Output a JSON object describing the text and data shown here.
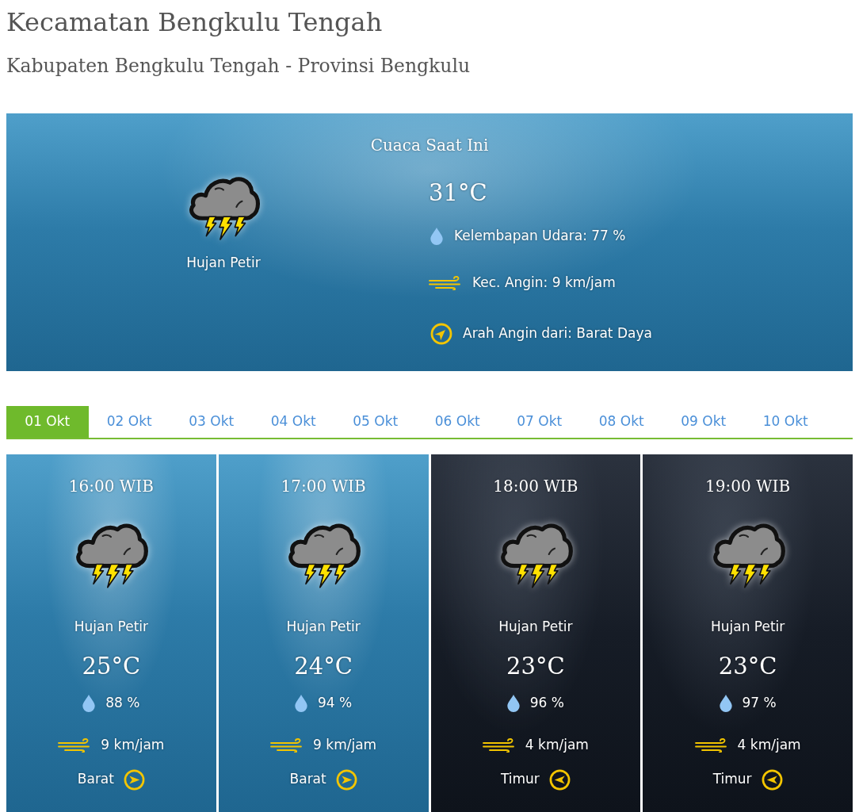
{
  "header": {
    "title": "Kecamatan Bengkulu Tengah",
    "subtitle": "Kabupaten Bengkulu Tengah - Provinsi Bengkulu"
  },
  "current": {
    "title": "Cuaca Saat Ini",
    "condition": "Hujan Petir",
    "temperature": "31°C",
    "humidity": "Kelembapan Udara: 77 %",
    "wind_speed": "Kec. Angin: 9 km/jam",
    "wind_direction": {
      "label": "Arah Angin dari: Barat Daya",
      "kind": "up-right"
    }
  },
  "tabs": [
    {
      "label": "01 Okt",
      "selected": true
    },
    {
      "label": "02 Okt",
      "selected": false
    },
    {
      "label": "03 Okt",
      "selected": false
    },
    {
      "label": "04 Okt",
      "selected": false
    },
    {
      "label": "05 Okt",
      "selected": false
    },
    {
      "label": "06 Okt",
      "selected": false
    },
    {
      "label": "07 Okt",
      "selected": false
    },
    {
      "label": "08 Okt",
      "selected": false
    },
    {
      "label": "09 Okt",
      "selected": false
    },
    {
      "label": "10 Okt",
      "selected": false
    }
  ],
  "forecast": [
    {
      "kind": "day",
      "time": "16:00 WIB",
      "condition": "Hujan Petir",
      "temperature": "25°C",
      "humidity": "88 %",
      "wind_speed": "9 km/jam",
      "wind_direction": {
        "label": "Barat",
        "kind": "right"
      }
    },
    {
      "kind": "day",
      "time": "17:00 WIB",
      "condition": "Hujan Petir",
      "temperature": "24°C",
      "humidity": "94 %",
      "wind_speed": "9 km/jam",
      "wind_direction": {
        "label": "Barat",
        "kind": "right"
      }
    },
    {
      "kind": "night",
      "time": "18:00 WIB",
      "condition": "Hujan Petir",
      "temperature": "23°C",
      "humidity": "96 %",
      "wind_speed": "4 km/jam",
      "wind_direction": {
        "label": "Timur",
        "kind": "left"
      }
    },
    {
      "kind": "night",
      "time": "19:00 WIB",
      "condition": "Hujan Petir",
      "temperature": "23°C",
      "humidity": "97 %",
      "wind_speed": "4 km/jam",
      "wind_direction": {
        "label": "Timur",
        "kind": "left"
      }
    }
  ]
}
